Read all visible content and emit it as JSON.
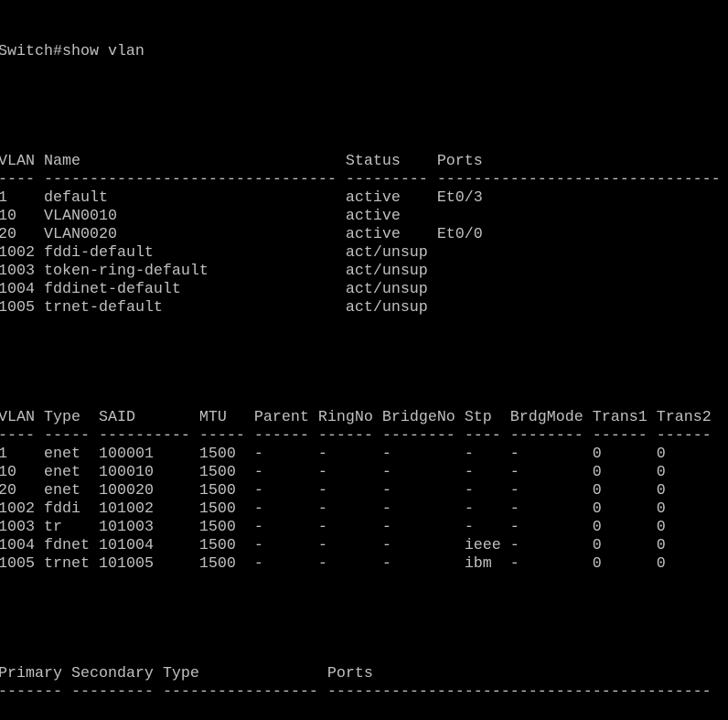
{
  "prompt": "Switch#show vlan",
  "vlan_table": {
    "headers": [
      "VLAN",
      "Name",
      "Status",
      "Ports"
    ],
    "separator": [
      "----",
      "--------------------------------",
      "---------",
      "-------------------------------"
    ],
    "rows": [
      [
        "1",
        "default",
        "active",
        "Et0/3"
      ],
      [
        "10",
        "VLAN0010",
        "active",
        ""
      ],
      [
        "20",
        "VLAN0020",
        "active",
        "Et0/0"
      ],
      [
        "1002",
        "fddi-default",
        "act/unsup",
        ""
      ],
      [
        "1003",
        "token-ring-default",
        "act/unsup",
        ""
      ],
      [
        "1004",
        "fddinet-default",
        "act/unsup",
        ""
      ],
      [
        "1005",
        "trnet-default",
        "act/unsup",
        ""
      ]
    ]
  },
  "type_table": {
    "headers": [
      "VLAN",
      "Type",
      "SAID",
      "MTU",
      "Parent",
      "RingNo",
      "BridgeNo",
      "Stp",
      "BrdgMode",
      "Trans1",
      "Trans2"
    ],
    "separator": [
      "----",
      "-----",
      "----------",
      "-----",
      "------",
      "------",
      "--------",
      "----",
      "--------",
      "------",
      "------"
    ],
    "rows": [
      [
        "1",
        "enet",
        "100001",
        "1500",
        "-",
        "-",
        "-",
        "-",
        "-",
        "0",
        "0"
      ],
      [
        "10",
        "enet",
        "100010",
        "1500",
        "-",
        "-",
        "-",
        "-",
        "-",
        "0",
        "0"
      ],
      [
        "20",
        "enet",
        "100020",
        "1500",
        "-",
        "-",
        "-",
        "-",
        "-",
        "0",
        "0"
      ],
      [
        "1002",
        "fddi",
        "101002",
        "1500",
        "-",
        "-",
        "-",
        "-",
        "-",
        "0",
        "0"
      ],
      [
        "1003",
        "tr",
        "101003",
        "1500",
        "-",
        "-",
        "-",
        "-",
        "-",
        "0",
        "0"
      ],
      [
        "1004",
        "fdnet",
        "101004",
        "1500",
        "-",
        "-",
        "-",
        "ieee",
        "-",
        "0",
        "0"
      ],
      [
        "1005",
        "trnet",
        "101005",
        "1500",
        "-",
        "-",
        "-",
        "ibm",
        "-",
        "0",
        "0"
      ]
    ]
  },
  "pvlan_table": {
    "headers": [
      "Primary",
      "Secondary",
      "Type",
      "Ports"
    ],
    "separator": [
      "-------",
      "---------",
      "-----------------",
      "------------------------------------------"
    ],
    "rows": []
  }
}
